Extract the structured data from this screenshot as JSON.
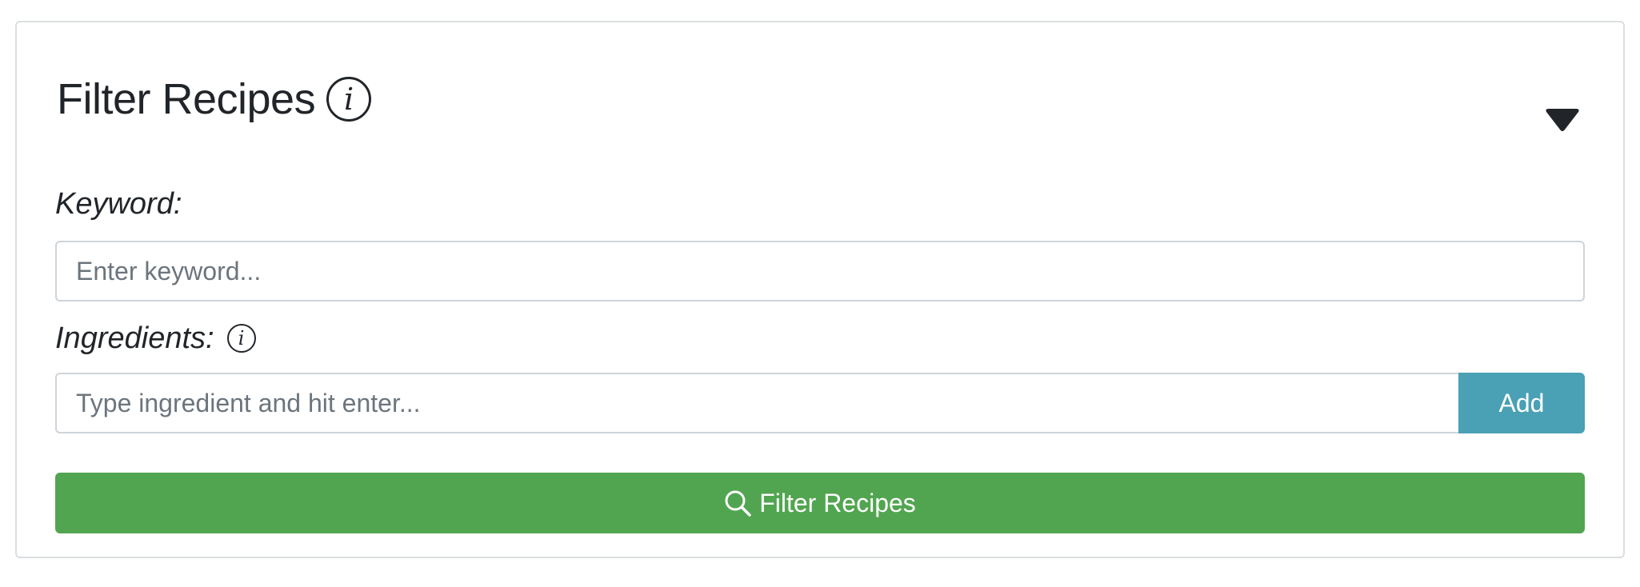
{
  "panel": {
    "title": "Filter Recipes",
    "info_icon": "info-icon",
    "toggle_icon": "caret-down-icon"
  },
  "keyword": {
    "label": "Keyword:",
    "placeholder": "Enter keyword...",
    "value": ""
  },
  "ingredients": {
    "label": "Ingredients:",
    "info_icon": "info-icon",
    "placeholder": "Type ingredient and hit enter...",
    "value": "",
    "add_label": "Add"
  },
  "submit": {
    "label": "Filter Recipes",
    "icon": "search-icon"
  },
  "colors": {
    "add_button": "#4aa0b5",
    "filter_button": "#52a550",
    "text": "#212529",
    "border": "#ced4da"
  }
}
